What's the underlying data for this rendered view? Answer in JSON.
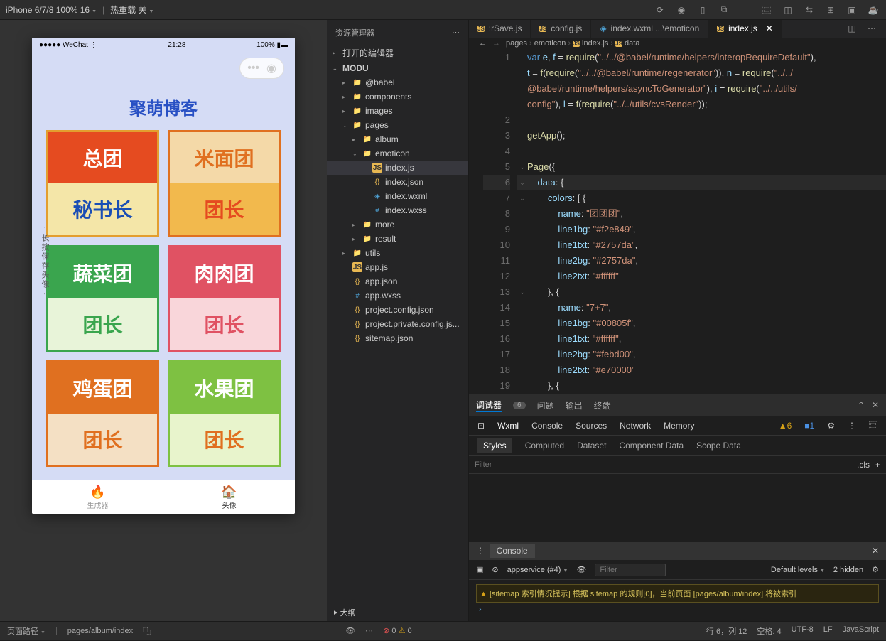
{
  "toolbar": {
    "device": "iPhone 6/7/8 100% 16",
    "hotreload": "热重载 关",
    "breadcrumb_arrows": "‹ ›"
  },
  "simulator": {
    "status_left": "●●●●● WeChat",
    "wifi": "⋮",
    "time": "21:28",
    "battery": "100%",
    "app_title": "聚萌博客",
    "side_text": "· 长按保存头像 ·",
    "tabbar": {
      "gen": "生成器",
      "avatar": "头像"
    },
    "cards": [
      {
        "border": "#e39e2f",
        "r1bg": "#e54b20",
        "r1txt": "#fff",
        "r1": "总团",
        "r2bg": "#f4e6a8",
        "r2txt": "#1a4eb5",
        "r2": "秘书长"
      },
      {
        "border": "#e07020",
        "r1bg": "#f4d9a8",
        "r1txt": "#e07020",
        "r1": "米面团",
        "r2bg": "#f2b94d",
        "r2txt": "#e54b20",
        "r2": "团长"
      },
      {
        "border": "#3aa54e",
        "r1bg": "#3aa54e",
        "r1txt": "#fff",
        "r1": "蔬菜团",
        "r2bg": "#e8f4d9",
        "r2txt": "#3aa54e",
        "r2": "团长"
      },
      {
        "border": "#e05263",
        "r1bg": "#e05263",
        "r1txt": "#fff",
        "r1": "肉肉团",
        "r2bg": "#f9d6da",
        "r2txt": "#e05263",
        "r2": "团长"
      },
      {
        "border": "#e07020",
        "r1bg": "#e07020",
        "r1txt": "#fff",
        "r1": "鸡蛋团",
        "r2bg": "#f4e0c4",
        "r2txt": "#e07020",
        "r2": "团长"
      },
      {
        "border": "#7ec142",
        "r1bg": "#7ec142",
        "r1txt": "#fff",
        "r1": "水果团",
        "r2bg": "#e8f4cc",
        "r2txt": "#e07020",
        "r2": "团长"
      }
    ]
  },
  "explorer": {
    "title": "资源管理器",
    "open_editors": "打开的编辑器",
    "root": "MODU",
    "outline": "大纲",
    "tree": [
      {
        "name": "@babel",
        "type": "folder",
        "depth": 1,
        "open": false
      },
      {
        "name": "components",
        "type": "folder",
        "depth": 1,
        "open": false
      },
      {
        "name": "images",
        "type": "folder",
        "depth": 1,
        "open": false
      },
      {
        "name": "pages",
        "type": "folder",
        "depth": 1,
        "open": true
      },
      {
        "name": "album",
        "type": "folder",
        "depth": 2,
        "open": false
      },
      {
        "name": "emoticon",
        "type": "folder",
        "depth": 2,
        "open": true
      },
      {
        "name": "index.js",
        "type": "js",
        "depth": 3,
        "selected": true
      },
      {
        "name": "index.json",
        "type": "json",
        "depth": 3
      },
      {
        "name": "index.wxml",
        "type": "wxml",
        "depth": 3
      },
      {
        "name": "index.wxss",
        "type": "wxss",
        "depth": 3
      },
      {
        "name": "more",
        "type": "folder",
        "depth": 2,
        "open": false
      },
      {
        "name": "result",
        "type": "folder",
        "depth": 2,
        "open": false
      },
      {
        "name": "utils",
        "type": "folder",
        "depth": 1,
        "open": false
      },
      {
        "name": "app.js",
        "type": "js",
        "depth": 1
      },
      {
        "name": "app.json",
        "type": "json",
        "depth": 1
      },
      {
        "name": "app.wxss",
        "type": "wxss",
        "depth": 1
      },
      {
        "name": "project.config.json",
        "type": "json",
        "depth": 1
      },
      {
        "name": "project.private.config.js...",
        "type": "json",
        "depth": 1
      },
      {
        "name": "sitemap.json",
        "type": "json",
        "depth": 1
      }
    ]
  },
  "tabs": [
    {
      "label": ":rSave.js",
      "icon": "js"
    },
    {
      "label": "config.js",
      "icon": "js"
    },
    {
      "label": "index.wxml ...\\emoticon",
      "icon": "wxml"
    },
    {
      "label": "index.js",
      "icon": "js",
      "active": true,
      "close": true
    }
  ],
  "breadcrumb": [
    "pages",
    "emoticon",
    "index.js",
    "data"
  ],
  "code": {
    "current_line": 6,
    "lines": [
      {
        "n": 1,
        "fold": "",
        "html": "<span class='kw'>var</span> <span class='prop'>e</span>, <span class='prop'>f</span> = <span class='fn'>require</span>(<span class='str'>\"../../@babel/runtime/helpers/interopRequireDefault\"</span>),"
      },
      {
        "n": "",
        "fold": "",
        "html": "<span class='prop'>t</span> = <span class='fn'>f</span>(<span class='fn'>require</span>(<span class='str'>\"../../@babel/runtime/regenerator\"</span>)), <span class='prop'>n</span> = <span class='fn'>require</span>(<span class='str'>\"../../</span>"
      },
      {
        "n": "",
        "fold": "",
        "html": "<span class='str'>@babel/runtime/helpers/asyncToGenerator\"</span>), <span class='prop'>i</span> = <span class='fn'>require</span>(<span class='str'>\"../../utils/</span>"
      },
      {
        "n": "",
        "fold": "",
        "html": "<span class='str'>config\"</span>), <span class='prop'>l</span> = <span class='fn'>f</span>(<span class='fn'>require</span>(<span class='str'>\"../../utils/cvsRender\"</span>));"
      },
      {
        "n": 2,
        "fold": "",
        "html": ""
      },
      {
        "n": 3,
        "fold": "",
        "html": "<span class='fn'>getApp</span>();"
      },
      {
        "n": 4,
        "fold": "",
        "html": ""
      },
      {
        "n": 5,
        "fold": "⌄",
        "html": "<span class='fn'>Page</span>({"
      },
      {
        "n": 6,
        "fold": "⌄",
        "html": "    <span class='prop'>data</span>: {",
        "active": true
      },
      {
        "n": 7,
        "fold": "⌄",
        "html": "        <span class='prop'>colors</span>: [ {"
      },
      {
        "n": 8,
        "fold": "",
        "html": "            <span class='prop'>name</span>: <span class='str'>\"团团团\"</span>,"
      },
      {
        "n": 9,
        "fold": "",
        "html": "            <span class='prop'>line1bg</span>: <span class='str'>\"#f2e849\"</span>,"
      },
      {
        "n": 10,
        "fold": "",
        "html": "            <span class='prop'>line1txt</span>: <span class='str'>\"#2757da\"</span>,"
      },
      {
        "n": 11,
        "fold": "",
        "html": "            <span class='prop'>line2bg</span>: <span class='str'>\"#2757da\"</span>,"
      },
      {
        "n": 12,
        "fold": "",
        "html": "            <span class='prop'>line2txt</span>: <span class='str'>\"#ffffff\"</span>"
      },
      {
        "n": 13,
        "fold": "⌄",
        "html": "        }, {"
      },
      {
        "n": 14,
        "fold": "",
        "html": "            <span class='prop'>name</span>: <span class='str'>\"7+7\"</span>,"
      },
      {
        "n": 15,
        "fold": "",
        "html": "            <span class='prop'>line1bg</span>: <span class='str'>\"#00805f\"</span>,"
      },
      {
        "n": 16,
        "fold": "",
        "html": "            <span class='prop'>line1txt</span>: <span class='str'>\"#ffffff\"</span>,"
      },
      {
        "n": 17,
        "fold": "",
        "html": "            <span class='prop'>line2bg</span>: <span class='str'>\"#febd00\"</span>,"
      },
      {
        "n": 18,
        "fold": "",
        "html": "            <span class='prop'>line2txt</span>: <span class='str'>\"#e70000\"</span>"
      },
      {
        "n": 19,
        "fold": "",
        "html": "        }, {"
      }
    ]
  },
  "devtools": {
    "tabs": {
      "debugger": "调试器",
      "badge": "6",
      "problems": "问题",
      "output": "输出",
      "terminal": "终端"
    },
    "inspector": [
      "Wxml",
      "Console",
      "Sources",
      "Network",
      "Memory"
    ],
    "warn_count": "6",
    "info_count": "1",
    "styles": [
      "Styles",
      "Computed",
      "Dataset",
      "Component Data",
      "Scope Data"
    ],
    "filter": "Filter",
    "cls": ".cls",
    "console": "Console",
    "context": "appservice (#4)",
    "filter2": "Filter",
    "levels": "Default levels",
    "hidden": "2 hidden",
    "log": "[sitemap 索引情况提示] 根据 sitemap 的规则[0]，当前页面 [pages/album/index] 将被索引"
  },
  "statusbar": {
    "path_label": "页面路径",
    "path": "pages/album/index",
    "errors": "0",
    "warnings": "0",
    "line_col": "行 6，列 12",
    "spaces": "空格: 4",
    "encoding": "UTF-8",
    "eol": "LF",
    "lang": "JavaScript"
  }
}
